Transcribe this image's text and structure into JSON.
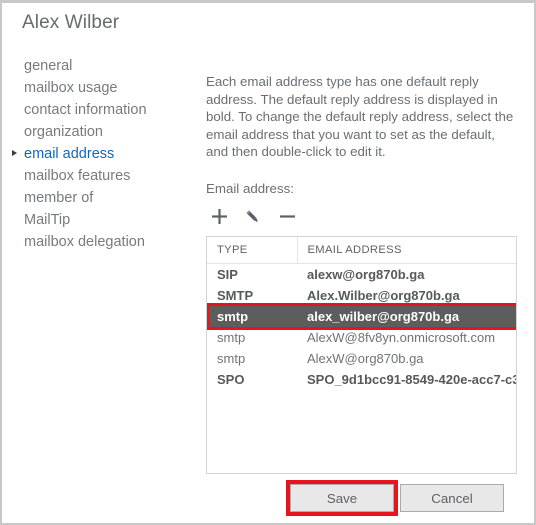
{
  "window": {
    "title": "Alex Wilber",
    "border_color": "#c8c8c8"
  },
  "sidebar": {
    "items": [
      {
        "label": "general",
        "active": false
      },
      {
        "label": "mailbox usage",
        "active": false
      },
      {
        "label": "contact information",
        "active": false
      },
      {
        "label": "organization",
        "active": false
      },
      {
        "label": "email address",
        "active": true
      },
      {
        "label": "mailbox features",
        "active": false
      },
      {
        "label": "member of",
        "active": false
      },
      {
        "label": "MailTip",
        "active": false
      },
      {
        "label": "mailbox delegation",
        "active": false
      }
    ]
  },
  "main": {
    "intro_text": "Each email address type has one default reply address. The default reply address is displayed in bold. To change the default reply address, select the email address that you want to set as the default, and then double-click to edit it.",
    "email_label": "Email address:",
    "toolbar": [
      {
        "name": "add-icon",
        "glyph": "+",
        "title": "Add"
      },
      {
        "name": "edit-pencil-icon",
        "glyph": "✎",
        "title": "Edit"
      },
      {
        "name": "remove-icon",
        "glyph": "−",
        "title": "Remove"
      }
    ],
    "table": {
      "columns": [
        "TYPE",
        "EMAIL ADDRESS"
      ],
      "rows": [
        {
          "type": "SIP",
          "address": "alexw@org870b.ga",
          "bold": true,
          "selected": false
        },
        {
          "type": "SMTP",
          "address": "Alex.Wilber@org870b.ga",
          "bold": true,
          "selected": false
        },
        {
          "type": "smtp",
          "address": "alex_wilber@org870b.ga",
          "bold": true,
          "selected": true
        },
        {
          "type": "smtp",
          "address": "AlexW@8fv8yn.onmicrosoft.com",
          "bold": false,
          "selected": false
        },
        {
          "type": "smtp",
          "address": "AlexW@org870b.ga",
          "bold": false,
          "selected": false
        },
        {
          "type": "SPO",
          "address": "SPO_9d1bcc91-8549-420e-acc7-c3...",
          "bold": true,
          "selected": false
        }
      ]
    }
  },
  "footer": {
    "save_label": "Save",
    "cancel_label": "Cancel"
  },
  "annotations": {
    "highlight_color": "#e8141b",
    "selected_row_bg": "#5d5d5d",
    "accent_link_color": "#1466b8"
  }
}
